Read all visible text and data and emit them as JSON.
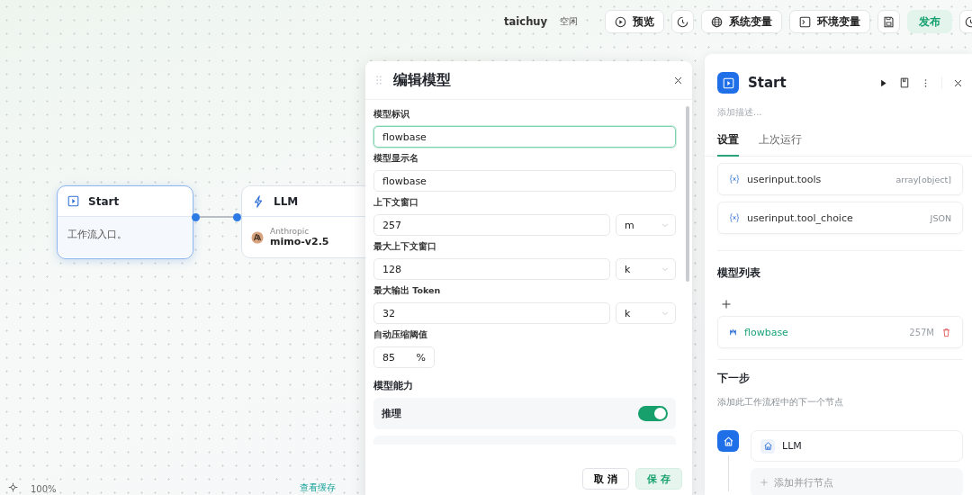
{
  "toolbar": {
    "user": "taichuy",
    "status": "空闲",
    "buttons": [
      {
        "kind": "preview",
        "label": "预览"
      },
      {
        "kind": "history"
      },
      {
        "kind": "variables",
        "label": "系统变量"
      },
      {
        "kind": "environment",
        "label": "环境变量"
      },
      {
        "kind": "save"
      },
      {
        "kind": "publish",
        "label": "发布"
      },
      {
        "kind": "history"
      }
    ]
  },
  "nodes": [
    {
      "kind": "start",
      "title": "Start",
      "description": "工作流入口。",
      "selected": true
    },
    {
      "kind": "llm",
      "title": "LLM",
      "provider": "Anthropic",
      "model": "mimo-v2.5",
      "selected": false
    }
  ],
  "canvas_footer": {
    "zoom": "100%",
    "link": "查看缓存"
  },
  "modal": {
    "title": "编辑模型",
    "fields": [
      {
        "kind": "text",
        "label": "模型标识",
        "value": "flowbase",
        "focused": true
      },
      {
        "kind": "text",
        "label": "模型显示名",
        "value": "flowbase",
        "focused": false
      },
      {
        "kind": "unit",
        "label": "上下文窗口",
        "value": "257",
        "unit": "m",
        "focused": false
      },
      {
        "kind": "unit",
        "label": "最大上下文窗口",
        "value": "128",
        "unit": "k",
        "focused": false
      },
      {
        "kind": "unit",
        "label": "最大输出 Token",
        "value": "32",
        "unit": "k",
        "focused": false
      },
      {
        "kind": "percent",
        "label": "自动压缩阈值",
        "value": "85",
        "suffix": "%",
        "focused": false
      }
    ],
    "capabilities_title": "模型能力",
    "capabilities": [
      {
        "label": "推理",
        "on": true
      }
    ],
    "cancel": "取 消",
    "save": "保 存"
  },
  "panel": {
    "title": "Start",
    "description_placeholder": "添加描述...",
    "tabs": [
      {
        "label": "设置",
        "selected": true
      },
      {
        "label": "上次运行",
        "selected": false
      }
    ],
    "variables": [
      {
        "name": "userinput.tools",
        "type": "array[object]"
      },
      {
        "name": "userinput.tool_choice",
        "type": "JSON"
      }
    ],
    "models_title": "模型列表",
    "models": [
      {
        "name": "flowbase",
        "size": "257M"
      }
    ],
    "next_title": "下一步",
    "next_hint": "添加此工作流程中的下一个节点",
    "next_nodes": [
      {
        "label": "LLM"
      }
    ],
    "add_parallel": "添加并行节点"
  }
}
